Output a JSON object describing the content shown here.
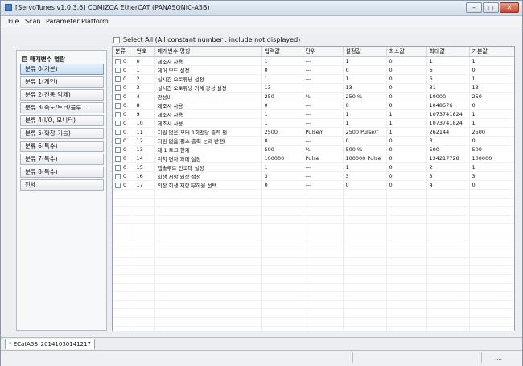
{
  "window": {
    "title": "[ServoTunes v1.0.3.6] COMIZOA EtherCAT (PANASONIC-A5B)",
    "buttons": {
      "minimize": "–",
      "maximize": "□",
      "close": "✕"
    }
  },
  "menu": [
    "File",
    "Scan",
    "Parameter",
    "Platform"
  ],
  "select_all_label": "Select All (All constant number : include not displayed)",
  "left_panel": {
    "header": "매개변수 열람",
    "header_box": "⊟",
    "categories": [
      "분류 0(기본)",
      "분류 1(게인)",
      "분류 2(진동 억제)",
      "분류 3(속도/토크/풀루...",
      "분류 4(I/O, 모니터)",
      "분류 5(확장 기능)",
      "분류 6(특수)",
      "분류 7(특수)",
      "분류 8(특수)",
      "전체"
    ]
  },
  "table": {
    "headers": [
      "분류",
      "번호",
      "매개변수 명칭",
      "입력값",
      "단위",
      "설정값",
      "최소값",
      "최대값",
      "기본값"
    ],
    "rows": [
      [
        "0",
        "0",
        "제조사 사용",
        "1",
        "---",
        "1",
        "0",
        "1",
        "1"
      ],
      [
        "0",
        "1",
        "제어 모드 설정",
        "0",
        "---",
        "0",
        "0",
        "6",
        "0"
      ],
      [
        "0",
        "2",
        "실시간 오토튜닝 설정",
        "1",
        "---",
        "1",
        "0",
        "6",
        "1"
      ],
      [
        "0",
        "3",
        "실시간 오토튜닝 기계 강성 설정",
        "13",
        "---",
        "13",
        "0",
        "31",
        "13"
      ],
      [
        "0",
        "4",
        "관성비",
        "250",
        "%",
        "250 %",
        "0",
        "10000",
        "250"
      ],
      [
        "0",
        "8",
        "제조사 사용",
        "0",
        "---",
        "0",
        "0",
        "1048576",
        "0"
      ],
      [
        "0",
        "9",
        "제조사 사용",
        "1",
        "---",
        "1",
        "1",
        "1073741824",
        "1"
      ],
      [
        "0",
        "10",
        "제조사 사용",
        "1",
        "---",
        "1",
        "1",
        "1073741824",
        "1"
      ],
      [
        "0",
        "11",
        "지원 없음(모터 1회전당 출력 펄...",
        "2500",
        "Pulse/r",
        "2500 Pulse/r",
        "1",
        "262144",
        "2500"
      ],
      [
        "0",
        "12",
        "지원 없음(펄스 출력 논리 반전)",
        "0",
        "---",
        "0",
        "0",
        "3",
        "0"
      ],
      [
        "0",
        "13",
        "제 1 토크 한계",
        "500",
        "%",
        "500 %",
        "0",
        "500",
        "500"
      ],
      [
        "0",
        "14",
        "위치 편차 과대 설정",
        "100000",
        "Pulse",
        "100000 Pulse",
        "0",
        "134217728",
        "100000"
      ],
      [
        "0",
        "15",
        "앱솔루트 인코더 설정",
        "1",
        "---",
        "1",
        "0",
        "2",
        "1"
      ],
      [
        "0",
        "16",
        "회생 저항 외장 설정",
        "3",
        "---",
        "3",
        "0",
        "3",
        "3"
      ],
      [
        "0",
        "17",
        "외장 회생 저항 부하율 선택",
        "0",
        "---",
        "0",
        "0",
        "4",
        "0"
      ]
    ]
  },
  "document_tab": "* ECatA5B_20141030141217",
  "status_bar": {
    "right_text": "...."
  }
}
